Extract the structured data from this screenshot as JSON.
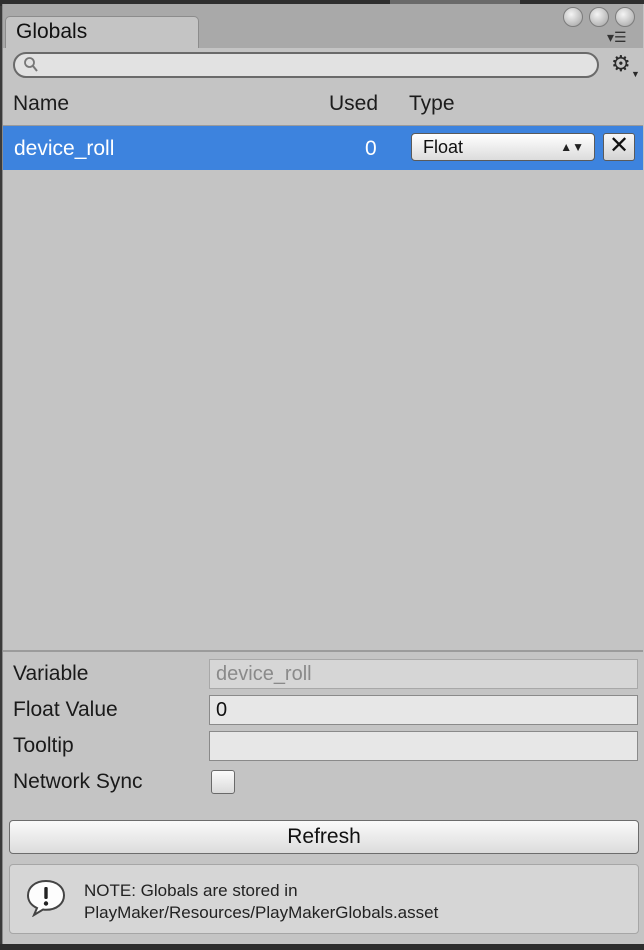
{
  "window": {
    "tab_title": "Globals"
  },
  "search": {
    "value": "",
    "placeholder": ""
  },
  "table": {
    "headers": {
      "name": "Name",
      "used": "Used",
      "type": "Type"
    },
    "rows": [
      {
        "name": "device_roll",
        "used": "0",
        "type": "Float",
        "selected": true
      }
    ]
  },
  "properties": {
    "variable_label": "Variable",
    "variable_value": "device_roll",
    "float_value_label": "Float Value",
    "float_value": "0",
    "tooltip_label": "Tooltip",
    "tooltip_value": "",
    "network_sync_label": "Network Sync",
    "network_sync_checked": false
  },
  "buttons": {
    "refresh": "Refresh"
  },
  "note": {
    "line1": "NOTE: Globals are stored in",
    "line2": "PlayMaker/Resources/PlayMakerGlobals.asset"
  },
  "colors": {
    "selection": "#3d83de",
    "panel": "#c4c4c4",
    "tab_bar": "#a9a9a9"
  },
  "icons": {
    "search": "magnifier-icon",
    "settings": "gear-icon",
    "delete": "close-icon",
    "note": "speech-bubble-alert-icon"
  }
}
